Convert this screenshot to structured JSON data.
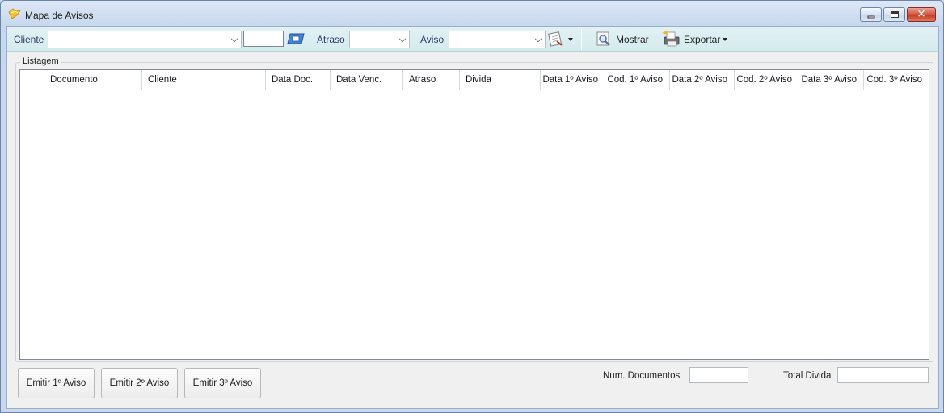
{
  "window": {
    "title": "Mapa de Avisos",
    "icon": "folder-key-icon"
  },
  "toolbar": {
    "cliente_label": "Cliente",
    "cliente_value": "",
    "cliente_code_value": "",
    "atraso_label": "Atraso",
    "atraso_value": "",
    "aviso_label": "Aviso",
    "aviso_value": "",
    "mostrar_label": "Mostrar",
    "exportar_label": "Exportar"
  },
  "group": {
    "title": "Listagem"
  },
  "grid": {
    "columns": [
      "",
      "Documento",
      "Cliente",
      "Data Doc.",
      "Data Venc.",
      "Atraso",
      "Divida",
      "Data 1º Aviso",
      "Cod. 1º Aviso",
      "Data 2º Aviso",
      "Cod. 2º Aviso",
      "Data 3º Aviso",
      "Cod. 3º Aviso"
    ],
    "rows": []
  },
  "footer": {
    "emitir1_label": "Emitir 1º Aviso",
    "emitir2_label": "Emitir 2º Aviso",
    "emitir3_label": "Emitir 3º Aviso",
    "num_documentos_label": "Num. Documentos",
    "num_documentos_value": "",
    "total_divida_label": "Total Divida",
    "total_divida_value": ""
  },
  "colors": {
    "toolbar_bg": "#d4ebee",
    "label_blue": "#2b3a63",
    "close_red": "#c33521"
  }
}
